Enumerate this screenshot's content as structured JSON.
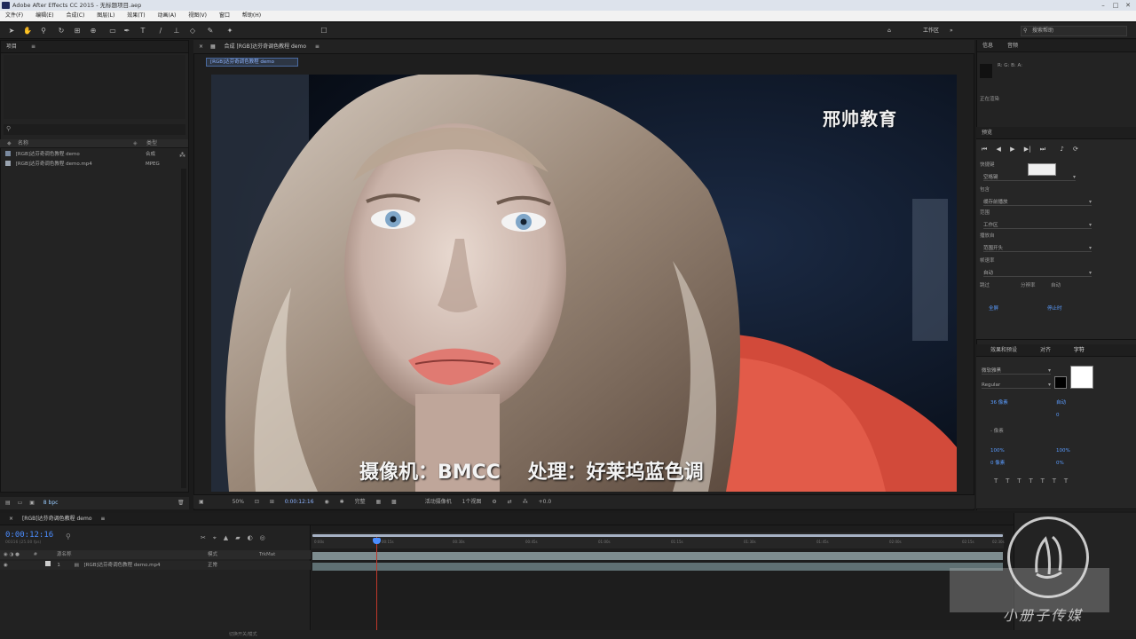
{
  "window": {
    "title": "Adobe After Effects CC 2015 - 无标题项目.aep"
  },
  "menu": {
    "items": [
      "文件(F)",
      "编辑(E)",
      "合成(C)",
      "图层(L)",
      "效果(T)",
      "动画(A)",
      "视图(V)",
      "窗口",
      "帮助(H)"
    ]
  },
  "toolbar": {
    "workspace_label": "工作区",
    "search_placeholder": "搜索帮助"
  },
  "project": {
    "tab": "项目",
    "col_name": "名称",
    "col_type": "类型",
    "items": [
      {
        "name": "[RGB]达芬奇调色教程 demo",
        "type": "合成"
      },
      {
        "name": "[RGB]达芬奇调色教程 demo.mp4",
        "type": "MPEG"
      }
    ],
    "footer": "8 bpc"
  },
  "composition": {
    "tab": "合成 [RGB]达芬奇调色教程 demo",
    "crumb": "[RGB]达芬奇调色教程 demo",
    "bottom_zoom": "50%",
    "bottom_timecode": "0:00:12:16",
    "bottom_quality": "完整",
    "bottom_camera": "活动摄像机",
    "bottom_views": "1个视图",
    "bottom_offset": "+0.0"
  },
  "overlay": {
    "brand": "邢帅教育",
    "caption": "摄像机：BMCC    处理：好莱坞蓝色调"
  },
  "right_panel": {
    "info_tab": "信息",
    "audio_tab": "音频",
    "info_line": "R: G: B: A:",
    "info_note": "正在渲染",
    "preview_tab": "预览",
    "shortcut_label": "快捷键",
    "shortcut_value": "空格键",
    "include_label": "包含",
    "cache_label": "缓存前播放",
    "range_label": "范围",
    "range_value": "工作区",
    "play_from_label": "播放自",
    "play_from_value": "范围开头",
    "framerate_label": "帧速率",
    "framerate_value": "自动",
    "skip_label": "跳过",
    "resolution_label": "分辨率",
    "resolution_value": "自动",
    "fullscreen_label": "全屏",
    "stop_label": "停止时",
    "char_tab": "字符",
    "effects_tab": "效果和预设",
    "align_tab": "对齐",
    "font_value": "微软雅黑",
    "font_style": "Regular",
    "size_value": "36 像素",
    "leading_value": "自动",
    "tracking_value": "0",
    "stroke_value": "- 像素",
    "scale_v": "100%",
    "scale_h": "100%",
    "baseline": "0 像素",
    "tsume": "0%"
  },
  "timeline": {
    "tab": "[RGB]达芬奇调色教程 demo",
    "timecode": "0:00:12:16",
    "fps_note": "00316 (25.00 fps)",
    "col_source": "源名称",
    "col_mode": "模式",
    "col_trkmat": "TrkMat",
    "layer_num": "1",
    "layer_name": "[RGB]达芬奇调色教程 demo.mp4",
    "layer_mode": "正常",
    "ruler_ticks": [
      "0:00s",
      "00:15s",
      "00:30s",
      "00:45s",
      "01:00s",
      "01:15s",
      "01:30s",
      "01:45s",
      "02:00s",
      "02:15s",
      "02:30s"
    ],
    "toggle_label": "切换开关/模式",
    "watermark_text": "小册子传媒"
  }
}
